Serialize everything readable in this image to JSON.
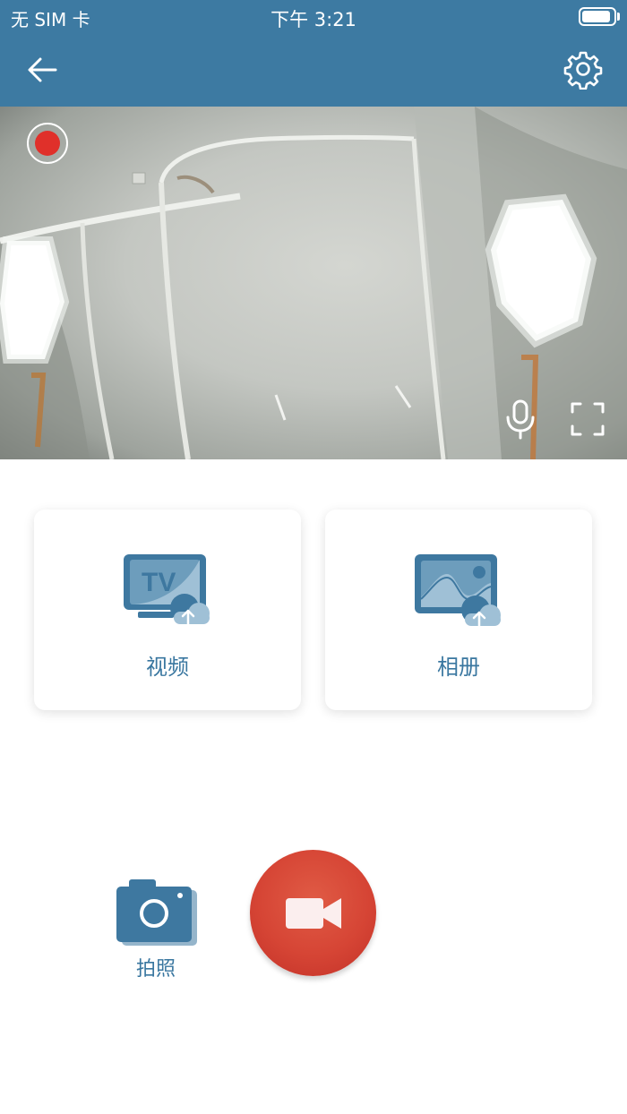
{
  "status_bar": {
    "carrier": "无 SIM 卡",
    "time": "下午 3:21",
    "battery_level": 0.9
  },
  "nav": {
    "back_icon": "arrow-left-icon",
    "settings_icon": "gear-icon"
  },
  "camera": {
    "recording_indicator_color": "#e0302a",
    "mic_icon": "microphone-icon",
    "fullscreen_icon": "fullscreen-icon"
  },
  "cards": {
    "video_label": "视频",
    "video_icon": "tv-upload-icon",
    "album_label": "相册",
    "album_icon": "image-upload-icon"
  },
  "controls": {
    "photo_label": "拍照",
    "photo_icon": "camera-icon",
    "record_icon": "video-camera-icon"
  },
  "colors": {
    "brand": "#3d7aa2",
    "label": "#3a77a0",
    "record": "#d64535"
  }
}
